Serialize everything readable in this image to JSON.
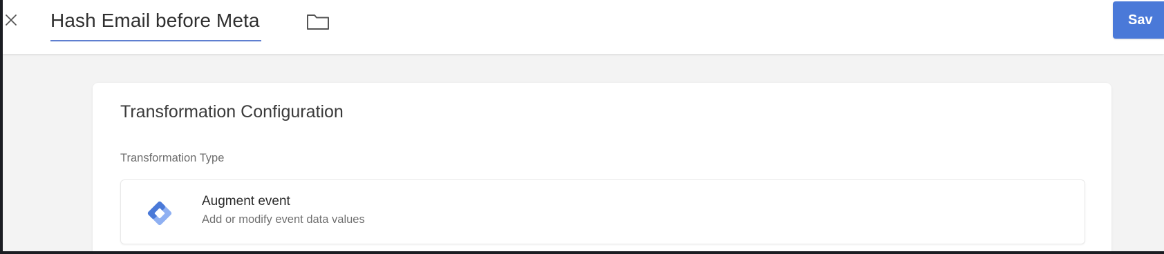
{
  "header": {
    "close_icon": "close-icon",
    "title": "Hash Email before Meta",
    "folder_icon": "folder-icon",
    "save_label": "Sav"
  },
  "card": {
    "title": "Transformation Configuration",
    "section_label": "Transformation Type",
    "option": {
      "icon": "augment-event-icon",
      "name": "Augment event",
      "description": "Add or modify event data values"
    }
  },
  "colors": {
    "accent_blue": "#4a79d8",
    "title_underline": "#5f7fd0",
    "page_background": "#f3f3f3"
  }
}
